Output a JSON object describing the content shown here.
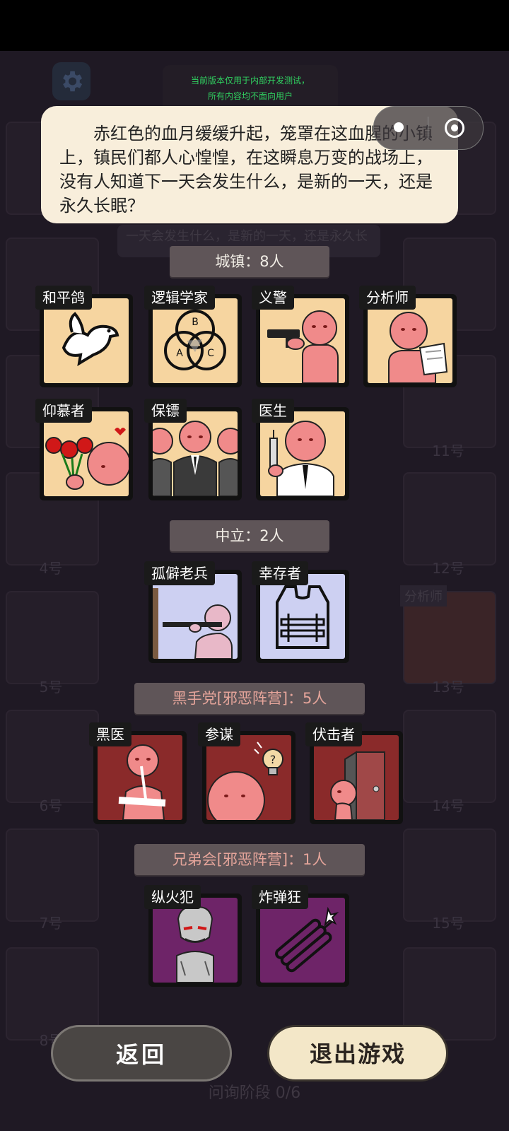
{
  "notice": {
    "line1": "当前版本仅用于内部开发测试，",
    "line2": "所有内容均不面向用户"
  },
  "story": "赤红色的血月缓缓升起，笼罩在这血腥的小镇上，镇民们都人心惶惶，在这瞬息万变的战场上，没有人知道下一天会发生什么，是新的一天，还是永久长眠？",
  "background": {
    "slot_numbers": [
      "4号",
      "5号",
      "6号",
      "7号",
      "8号",
      "11号",
      "12号",
      "13号",
      "14号",
      "15号"
    ],
    "faded_text": "一天会发生什么，是新的一天，还是永久长",
    "faded_role": "分析师",
    "phase": "问询阶段 0/6"
  },
  "sections": [
    {
      "title": "城镇：8人",
      "roles": [
        "和平鸽",
        "逻辑学家",
        "义警",
        "分析师",
        "仰慕者",
        "保镖",
        "医生"
      ]
    },
    {
      "title": "中立：2人",
      "roles": [
        "孤僻老兵",
        "幸存者"
      ]
    },
    {
      "title": "黑手党[邪恶阵营]：5人",
      "roles": [
        "黑医",
        "参谋",
        "伏击者"
      ]
    },
    {
      "title": "兄弟会[邪恶阵营]：1人",
      "roles": [
        "纵火犯",
        "炸弹狂"
      ]
    }
  ],
  "venn_letters": [
    "B",
    "A",
    "C"
  ],
  "buttons": {
    "back": "返回",
    "exit": "退出游戏"
  },
  "colors": {
    "town": "#f6d5a0",
    "neutral": "#cdd0f2",
    "mafia": "#8a2a2a",
    "brotherhood": "#6e2468",
    "notice_text": "#30d060"
  }
}
